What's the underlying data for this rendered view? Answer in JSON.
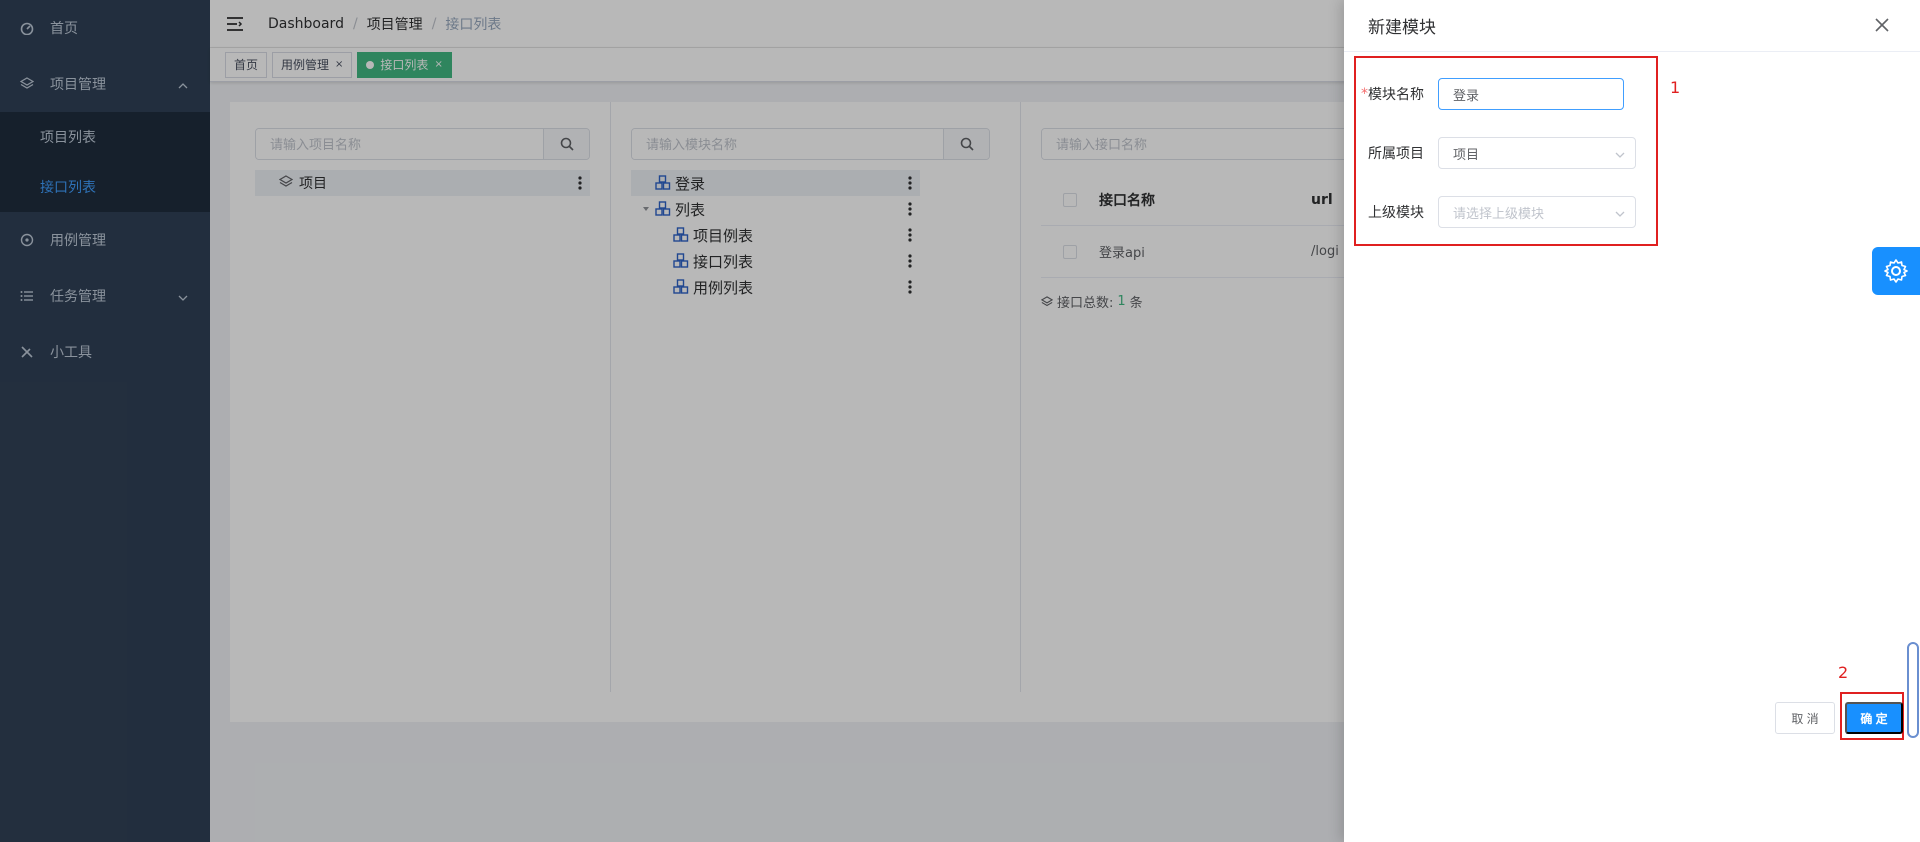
{
  "sidebar": {
    "items": [
      {
        "label": "首页",
        "icon": "dashboard-icon"
      },
      {
        "label": "项目管理",
        "icon": "layers-icon",
        "expanded": true,
        "children": [
          {
            "label": "项目列表"
          },
          {
            "label": "接口列表",
            "active": true
          }
        ]
      },
      {
        "label": "用例管理",
        "icon": "compass-icon"
      },
      {
        "label": "任务管理",
        "icon": "list-icon"
      },
      {
        "label": "小工具",
        "icon": "tools-icon"
      }
    ]
  },
  "navbar": {
    "breadcrumb": [
      "Dashboard",
      "项目管理",
      "接口列表"
    ]
  },
  "tags": [
    {
      "label": "首页"
    },
    {
      "label": "用例管理",
      "close": "×"
    },
    {
      "label": "接口列表",
      "close": "×",
      "active": true
    }
  ],
  "panels": {
    "project": {
      "placeholder": "请输入项目名称",
      "tree": [
        {
          "label": "项目"
        }
      ]
    },
    "module": {
      "placeholder": "请输入模块名称",
      "tree": [
        {
          "label": "登录"
        },
        {
          "label": "列表"
        },
        {
          "label": "项目例表"
        },
        {
          "label": "接口列表"
        },
        {
          "label": "用例列表"
        }
      ]
    },
    "api": {
      "placeholder": "请输入接口名称",
      "columns": [
        "接口名称",
        "url"
      ],
      "rows": [
        {
          "name": "登录api",
          "url": "/logi"
        }
      ],
      "summary_label": "接口总数:",
      "summary_count": "1",
      "summary_unit": "条"
    }
  },
  "drawer": {
    "title": "新建模块",
    "fields": {
      "module_name": {
        "label": "模块名称",
        "value": "登录",
        "required": "*"
      },
      "project": {
        "label": "所属项目",
        "value": "项目"
      },
      "parent_module": {
        "label": "上级模块",
        "placeholder": "请选择上级模块"
      }
    },
    "cancel_label": "取 消",
    "confirm_label": "确 定"
  },
  "annotations": {
    "box1": "1",
    "box2": "2"
  },
  "colors": {
    "sidebar": "#304156",
    "accent": "#409eff",
    "tag_active": "#42b983",
    "confirm": "#1890ff",
    "annotation": "#e02020"
  }
}
